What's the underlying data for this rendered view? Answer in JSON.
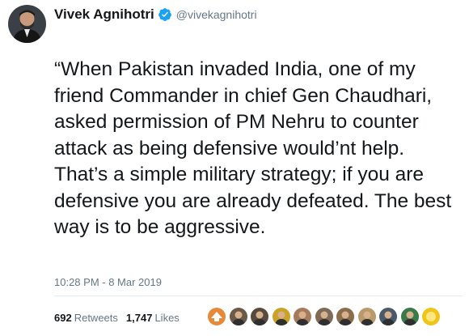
{
  "tweet": {
    "author": {
      "name": "Vivek Agnihotri",
      "handle": "@vivekagnihotri",
      "verified": true
    },
    "text": "“When Pakistan invaded India, one of my friend Commander in chief Gen Chaudhari, asked permission of PM Nehru to counter attack as being defensive would’nt help. That’s a simple military strategy; if you are defensive you are already defeated. The best way is to be aggressive.",
    "timestamp": "10:28 PM - 8 Mar 2019",
    "stats": {
      "retweets_count": "692",
      "retweets_label": "Retweets",
      "likes_count": "1,747",
      "likes_label": "Likes"
    },
    "likers": [
      {
        "color": "#e8893a"
      },
      {
        "color": "#6b5a4a"
      },
      {
        "color": "#5a4a3e"
      },
      {
        "color": "#c9a227"
      },
      {
        "color": "#a67b5b"
      },
      {
        "color": "#7d6a58"
      },
      {
        "color": "#8a6e4b"
      },
      {
        "color": "#b89a6c"
      },
      {
        "color": "#4a5a6a"
      },
      {
        "color": "#3a7a4a"
      },
      {
        "color": "#f0c419"
      }
    ]
  },
  "colors": {
    "verified_blue": "#1da1f2",
    "secondary_text": "#657786",
    "primary_text": "#14171a"
  }
}
